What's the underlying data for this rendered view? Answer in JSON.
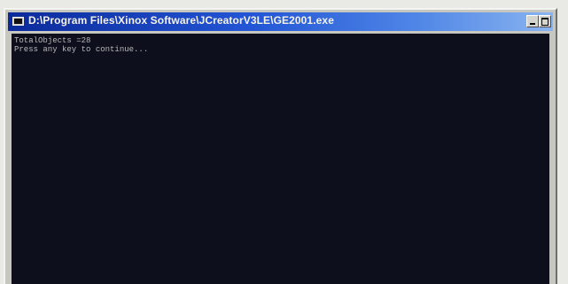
{
  "window": {
    "title": "D:\\Program Files\\Xinox Software\\JCreatorV3LE\\GE2001.exe"
  },
  "console": {
    "lines": [
      "TotalObjects =28",
      "Press any key to continue..."
    ]
  },
  "icons": {
    "system_menu": "console-window-icon",
    "minimize": "minimize-icon",
    "maximize": "maximize-icon"
  },
  "colors": {
    "titlebar_start": "#0b2a9a",
    "titlebar_end": "#8ab4f0",
    "console_bg": "#0d0f1c",
    "console_text": "#b8b8b8"
  }
}
